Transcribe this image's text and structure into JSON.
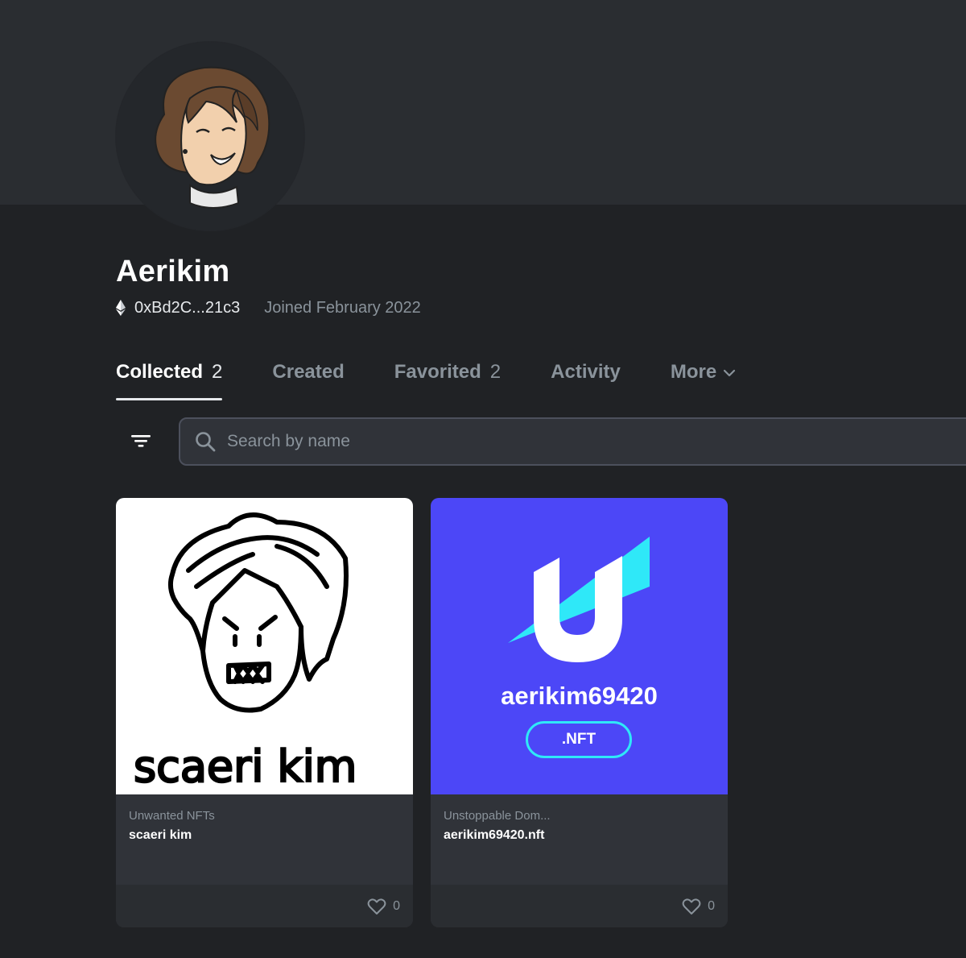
{
  "profile": {
    "name": "Aerikim",
    "address": "0xBd2C...21c3",
    "joined": "Joined February 2022"
  },
  "tabs": [
    {
      "label": "Collected",
      "count": "2"
    },
    {
      "label": "Created",
      "count": ""
    },
    {
      "label": "Favorited",
      "count": "2"
    },
    {
      "label": "Activity",
      "count": ""
    },
    {
      "label": "More",
      "count": ""
    }
  ],
  "search": {
    "placeholder": "Search by name",
    "value": ""
  },
  "items": [
    {
      "collection": "Unwanted NFTs",
      "title": "scaeri kim",
      "image_text": "scaeri kim",
      "favorites": "0"
    },
    {
      "collection": "Unstoppable Dom...",
      "title": "aerikim69420.nft",
      "image_name": "aerikim69420",
      "image_tld": ".NFT",
      "favorites": "0"
    }
  ],
  "colors": {
    "background": "#202225",
    "banner": "#2a2d31",
    "card": "#303339",
    "unstoppable_bg": "#4c47f7",
    "unstoppable_accent": "#2fe8f8"
  },
  "icons": [
    "ethereum-icon",
    "chevron-down-icon",
    "filter-icon",
    "search-icon",
    "heart-icon"
  ]
}
